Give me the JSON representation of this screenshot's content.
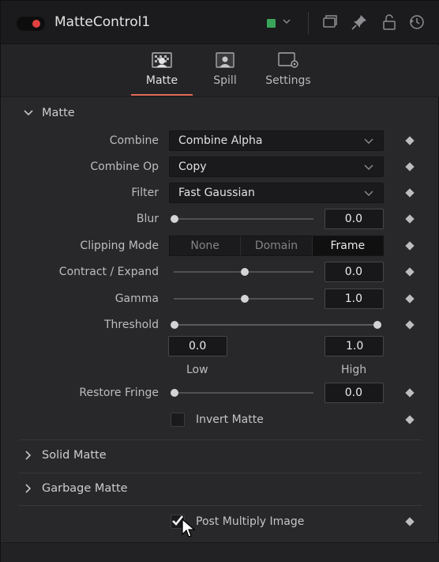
{
  "header": {
    "title": "MatteControl1",
    "enabled": true,
    "color_chip": "#3aa55a",
    "icons": [
      "chevron-down-icon",
      "versions-icon",
      "pin-icon",
      "lock-icon",
      "reset-icon"
    ]
  },
  "tabs": [
    {
      "label": "Matte",
      "icon": "matte-tab-icon",
      "active": true
    },
    {
      "label": "Spill",
      "icon": "spill-tab-icon",
      "active": false
    },
    {
      "label": "Settings",
      "icon": "settings-tab-icon",
      "active": false
    }
  ],
  "matte_section": {
    "label": "Matte",
    "expanded": true,
    "combine": {
      "label": "Combine",
      "value": "Combine Alpha"
    },
    "combine_op": {
      "label": "Combine Op",
      "value": "Copy"
    },
    "filter": {
      "label": "Filter",
      "value": "Fast Gaussian"
    },
    "blur": {
      "label": "Blur",
      "value": "0.0",
      "fraction": 0.0
    },
    "clipping_mode": {
      "label": "Clipping Mode",
      "options": [
        "None",
        "Domain",
        "Frame"
      ],
      "selected": "Frame"
    },
    "contract_expand": {
      "label": "Contract / Expand",
      "value": "0.0",
      "fraction": 0.5
    },
    "gamma": {
      "label": "Gamma",
      "value": "1.0",
      "fraction": 0.5
    },
    "threshold": {
      "label": "Threshold",
      "low_value": "0.0",
      "high_value": "1.0",
      "low_label": "Low",
      "high_label": "High",
      "low_fraction": 0.0,
      "high_fraction": 1.0
    },
    "restore_fringe": {
      "label": "Restore Fringe",
      "value": "0.0",
      "fraction": 0.0
    },
    "invert_matte": {
      "label": "Invert Matte",
      "checked": false
    }
  },
  "solid_matte": {
    "label": "Solid Matte",
    "expanded": false
  },
  "garbage_matte": {
    "label": "Garbage Matte",
    "expanded": false
  },
  "post_multiply": {
    "label": "Post Multiply Image",
    "checked": true
  }
}
